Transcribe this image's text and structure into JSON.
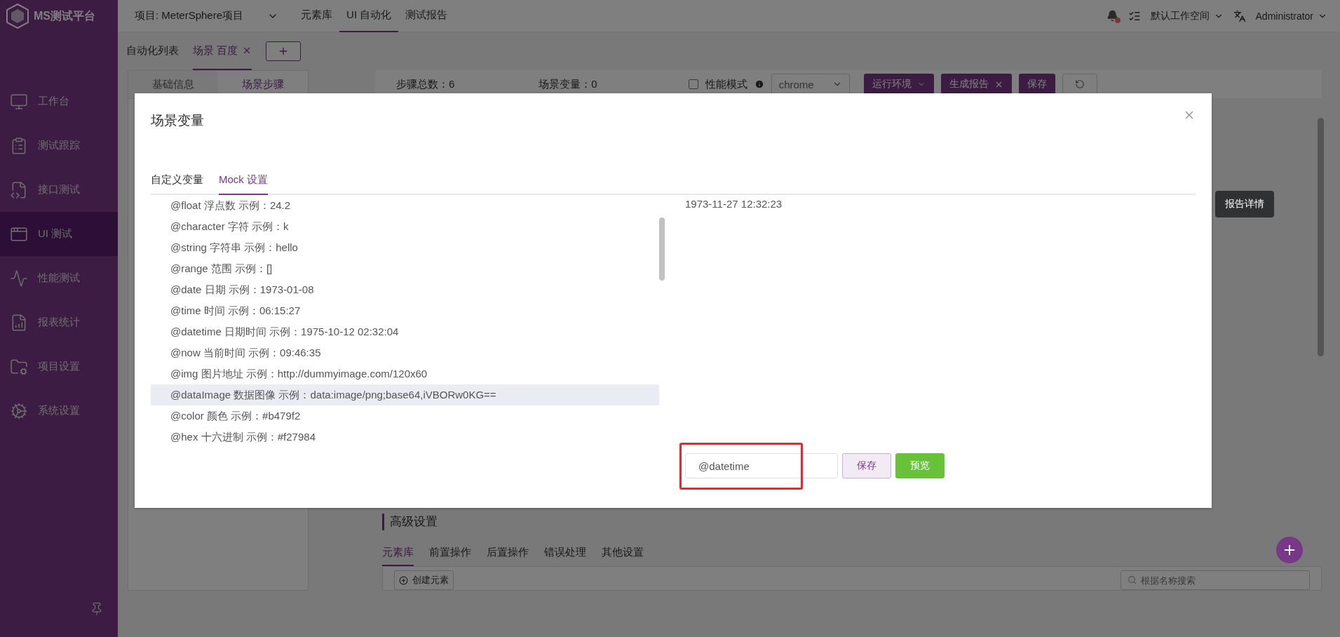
{
  "app": {
    "logo": "MS测试平台"
  },
  "header": {
    "project": "项目: MeterSphere项目",
    "nav": [
      {
        "label": "元素库",
        "selected": false
      },
      {
        "label": "UI 自动化",
        "selected": true
      },
      {
        "label": "测试报告",
        "selected": false
      }
    ],
    "notification": {
      "unread": true
    },
    "workspace": "默认工作空间",
    "user": "Administrator"
  },
  "sidebar": {
    "items": [
      {
        "label": "工作台",
        "selected": false
      },
      {
        "label": "测试跟踪",
        "selected": false
      },
      {
        "label": "接口测试",
        "selected": false
      },
      {
        "label": "UI 测试",
        "selected": true
      },
      {
        "label": "性能测试",
        "selected": false
      },
      {
        "label": "报表统计",
        "selected": false
      },
      {
        "label": "项目设置",
        "selected": false
      },
      {
        "label": "系统设置",
        "selected": false
      }
    ]
  },
  "page_tabs": [
    {
      "label": "自动化列表",
      "selected": false,
      "closable": false
    },
    {
      "label": "场景 百度",
      "selected": true,
      "closable": true
    }
  ],
  "left_panel": {
    "tabs": [
      {
        "label": "基础信息",
        "selected": false
      },
      {
        "label": "场景步骤",
        "selected": true
      }
    ]
  },
  "toolbar": {
    "step_count": "步骤总数：6",
    "variable_count": "场景变量：0",
    "performance_mode": {
      "label": "性能模式",
      "checked": false
    },
    "browser": "chrome",
    "buttons": [
      {
        "label": "运行环境",
        "kind": "dropdown"
      },
      {
        "label": "生成报告",
        "kind": "split"
      },
      {
        "label": "保存",
        "kind": "plain"
      }
    ]
  },
  "tooltip": "报告详情",
  "advanced": {
    "title": "高级设置",
    "tabs": [
      {
        "label": "元素库",
        "selected": true
      },
      {
        "label": "前置操作",
        "selected": false
      },
      {
        "label": "后置操作",
        "selected": false
      },
      {
        "label": "错误处理",
        "selected": false
      },
      {
        "label": "其他设置",
        "selected": false
      }
    ],
    "create_button": "创建元素",
    "search": {
      "placeholder": "根据名称搜索"
    }
  },
  "dialog": {
    "title": "场景变量",
    "tabs": [
      {
        "label": "自定义变量",
        "selected": false
      },
      {
        "label": "Mock 设置",
        "selected": true
      }
    ],
    "mock_rows": [
      {
        "text": "@float 浮点数 示例：24.2",
        "selected": false
      },
      {
        "text": "@character 字符 示例：k",
        "selected": false
      },
      {
        "text": "@string 字符串 示例：hello",
        "selected": false
      },
      {
        "text": "@range 范围 示例：[]",
        "selected": false
      },
      {
        "text": "@date 日期 示例：1973-01-08",
        "selected": false
      },
      {
        "text": "@time 时间 示例：06:15:27",
        "selected": false
      },
      {
        "text": "@datetime 日期时间 示例：1975-10-12 02:32:04",
        "selected": false
      },
      {
        "text": "@now 当前时间 示例：09:46:35",
        "selected": false
      },
      {
        "text": "@img 图片地址 示例：http://dummyimage.com/120x60",
        "selected": false
      },
      {
        "text": "@dataImage 数据图像 示例：data:image/png;base64,iVBORw0KG==",
        "selected": true
      },
      {
        "text": "@color 颜色 示例：#b479f2",
        "selected": false
      },
      {
        "text": "@hex 十六进制 示例：#f27984",
        "selected": false
      }
    ],
    "preview": "1973-11-27 12:32:23",
    "expression": {
      "value": "@datetime",
      "highlighted": true
    },
    "buttons": [
      {
        "label": "保存",
        "kind": "secondary"
      },
      {
        "label": "预览",
        "kind": "primary"
      }
    ]
  }
}
